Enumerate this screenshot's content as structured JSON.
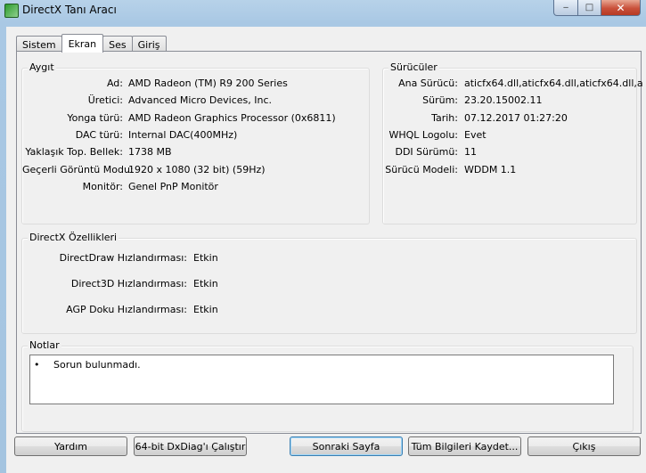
{
  "window": {
    "title": "DirectX Tanı Aracı",
    "caption": {
      "minimize": "‒",
      "maximize": "□",
      "close": "✕"
    }
  },
  "tabs": [
    {
      "label": "Sistem",
      "active": false
    },
    {
      "label": "Ekran",
      "active": true
    },
    {
      "label": "Ses",
      "active": false
    },
    {
      "label": "Giriş",
      "active": false
    }
  ],
  "device": {
    "title": "Aygıt",
    "rows": [
      {
        "label": "Ad:",
        "value": "AMD Radeon (TM) R9 200 Series"
      },
      {
        "label": "Üretici:",
        "value": "Advanced Micro Devices, Inc."
      },
      {
        "label": "Yonga türü:",
        "value": "AMD Radeon Graphics Processor (0x6811)"
      },
      {
        "label": "DAC türü:",
        "value": "Internal DAC(400MHz)"
      },
      {
        "label": "Yaklaşık Top. Bellek:",
        "value": "1738 MB"
      },
      {
        "label": "Geçerli Görüntü Modu:",
        "value": "1920 x 1080 (32 bit) (59Hz)"
      },
      {
        "label": "Monitör:",
        "value": "Genel PnP Monitör"
      }
    ]
  },
  "drivers": {
    "title": "Sürücüler",
    "rows": [
      {
        "label": "Ana Sürücü:",
        "value": "aticfx64.dll,aticfx64.dll,aticfx64.dll,a"
      },
      {
        "label": "Sürüm:",
        "value": "23.20.15002.11"
      },
      {
        "label": "Tarih:",
        "value": "07.12.2017 01:27:20"
      },
      {
        "label": "WHQL Logolu:",
        "value": "Evet"
      },
      {
        "label": "DDI Sürümü:",
        "value": "11"
      },
      {
        "label": "Sürücü Modeli:",
        "value": "WDDM 1.1"
      }
    ]
  },
  "features": {
    "title": "DirectX Özellikleri",
    "rows": [
      {
        "label": "DirectDraw Hızlandırması:",
        "value": "Etkin"
      },
      {
        "label": "Direct3D Hızlandırması:",
        "value": "Etkin"
      },
      {
        "label": "AGP Doku Hızlandırması:",
        "value": "Etkin"
      }
    ]
  },
  "notes": {
    "title": "Notlar",
    "items": [
      {
        "bullet": "•",
        "text": "Sorun bulunmadı."
      }
    ]
  },
  "buttons": {
    "help": "Yardım",
    "run64": "64-bit DxDiag'ı Çalıştır",
    "next": "Sonraki Sayfa",
    "saveall": "Tüm Bilgileri Kaydet...",
    "exit": "Çıkış"
  }
}
